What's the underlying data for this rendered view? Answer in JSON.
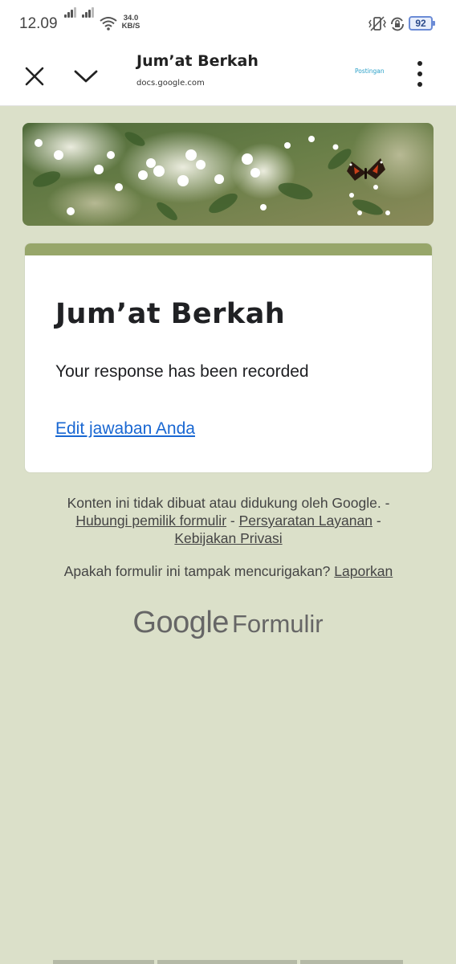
{
  "status_bar": {
    "time": "12.09",
    "net_speed_value": "34.0",
    "net_speed_unit": "KB/S",
    "battery": "92"
  },
  "toolbar": {
    "title": "Jum’at Berkah",
    "url": "docs.google.com",
    "post_label": "Postingan",
    "icons": [
      "close-icon",
      "chevron-down-icon",
      "more-vert-icon"
    ]
  },
  "card": {
    "title": "Jum’at Berkah",
    "message": "Your response has been recorded",
    "edit_link": "Edit jawaban Anda",
    "accent_color": "#97a66a"
  },
  "footer": {
    "disclaimer": "Konten ini tidak dibuat atau didukung oleh Google.",
    "sep": "-",
    "contact_link": "Hubungi pemilik formulir",
    "terms_link": "Persyaratan Layanan",
    "privacy_link": "Kebijakan Privasi",
    "suspicious_question": "Apakah formulir ini tampak mencurigakan?",
    "report_link": "Laporkan"
  },
  "brand": {
    "google": "Google",
    "forms": "Formulir"
  },
  "colors": {
    "page_background": "#dbe0c9",
    "link": "#1967d2"
  }
}
